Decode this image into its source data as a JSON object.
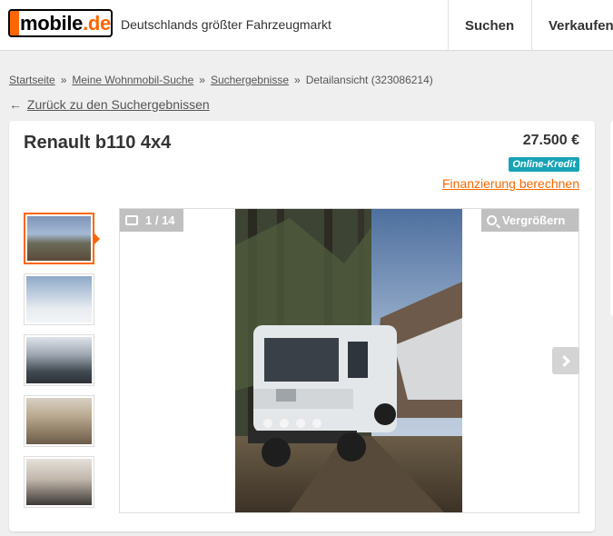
{
  "header": {
    "logo_main": "mobile",
    "logo_tld": ".de",
    "tagline": "Deutschlands größter Fahrzeugmarkt",
    "nav": {
      "search": "Suchen",
      "sell": "Verkaufen"
    }
  },
  "breadcrumb": {
    "items": [
      "Startseite",
      "Meine Wohnmobil-Suche",
      "Suchergebnisse"
    ],
    "current": "Detailansicht (323086214)",
    "separator": "»"
  },
  "back_link": {
    "arrow": "←",
    "label": "Zurück zu den Suchergebnissen"
  },
  "listing": {
    "title": "Renault b110 4x4",
    "price": "27.500 €",
    "badge": "Online-Kredit",
    "financing_link": "Finanzierung berechnen"
  },
  "gallery": {
    "counter": "1 / 14",
    "zoom_label": "Vergrößern",
    "thumbnails": [
      "van-exterior-snow",
      "van-snow-scene",
      "cab-interior",
      "seating-interior",
      "interior-detail"
    ],
    "accent_color": "#ff6600"
  },
  "colors": {
    "brand": "#ff6600",
    "badge": "#18a3b5"
  }
}
